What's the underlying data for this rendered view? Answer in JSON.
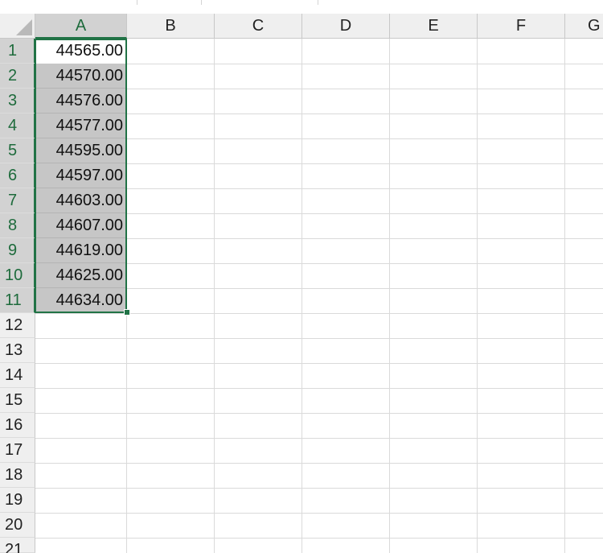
{
  "spreadsheet": {
    "columns": [
      "A",
      "B",
      "C",
      "D",
      "E",
      "F",
      "G"
    ],
    "selected_column": "A",
    "rows": [
      "1",
      "2",
      "3",
      "4",
      "5",
      "6",
      "7",
      "8",
      "9",
      "10",
      "11",
      "12",
      "13",
      "14",
      "15",
      "16",
      "17",
      "18",
      "19",
      "20",
      "21"
    ],
    "selected_rows": [
      "1",
      "2",
      "3",
      "4",
      "5",
      "6",
      "7",
      "8",
      "9",
      "10",
      "11"
    ],
    "active_cell": "A1",
    "column_a_values": [
      "44565.00",
      "44570.00",
      "44576.00",
      "44577.00",
      "44595.00",
      "44597.00",
      "44603.00",
      "44607.00",
      "44619.00",
      "44625.00",
      "44634.00"
    ],
    "colors": {
      "selection_accent": "#217346",
      "header_bg": "#efefef",
      "selected_header_bg": "#d2d2d2",
      "selected_cell_bg": "#c6c6c6",
      "gridline": "#dadada"
    }
  }
}
